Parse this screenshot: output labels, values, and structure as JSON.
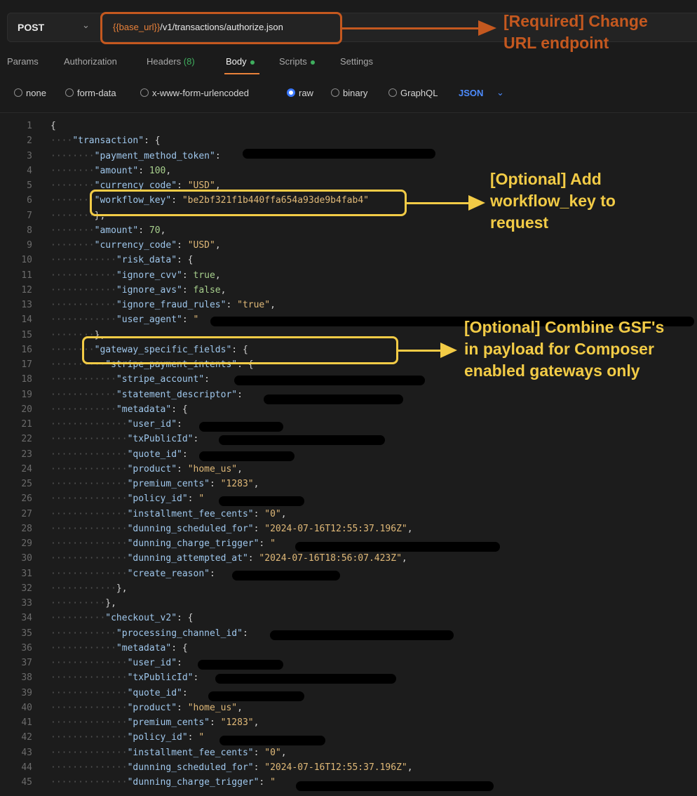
{
  "request": {
    "method": "POST",
    "method_chevron": "⌄",
    "url_var": "{{base_url}}",
    "url_path": "/v1/transactions/authorize.json"
  },
  "tabs": [
    {
      "label": "Params"
    },
    {
      "label": "Authorization"
    },
    {
      "label": "Headers",
      "count": "(8)"
    },
    {
      "label": "Body"
    },
    {
      "label": "Scripts"
    },
    {
      "label": "Settings"
    }
  ],
  "body_types": [
    "none",
    "form-data",
    "x-www-form-urlencoded",
    "raw",
    "binary",
    "GraphQL"
  ],
  "body_format": "JSON",
  "code_lines": [
    [
      [
        "p",
        "{"
      ]
    ],
    [
      [
        "g",
        "····"
      ],
      [
        "k",
        "\"transaction\""
      ],
      [
        "p",
        ": {"
      ]
    ],
    [
      [
        "g",
        "········"
      ],
      [
        "k",
        "\"payment_method_token\""
      ],
      [
        "p",
        ": "
      ]
    ],
    [
      [
        "g",
        "········"
      ],
      [
        "k",
        "\"amount\""
      ],
      [
        "p",
        ": "
      ],
      [
        "n",
        "100"
      ],
      [
        "p",
        ","
      ]
    ],
    [
      [
        "g",
        "········"
      ],
      [
        "k",
        "\"currency_code\""
      ],
      [
        "p",
        ": "
      ],
      [
        "s",
        "\"USD\""
      ],
      [
        "p",
        ","
      ]
    ],
    [
      [
        "g",
        "········"
      ],
      [
        "k",
        "\"workflow_key\""
      ],
      [
        "p",
        ": "
      ],
      [
        "s",
        "\"be2bf321f1b440ffa654a93de9b4fab4\""
      ]
    ],
    [
      [
        "g",
        "········"
      ],
      [
        "p",
        "},"
      ]
    ],
    [
      [
        "g",
        "········"
      ],
      [
        "k",
        "\"amount\""
      ],
      [
        "p",
        ": "
      ],
      [
        "n",
        "70"
      ],
      [
        "p",
        ","
      ]
    ],
    [
      [
        "g",
        "········"
      ],
      [
        "k",
        "\"currency_code\""
      ],
      [
        "p",
        ": "
      ],
      [
        "s",
        "\"USD\""
      ],
      [
        "p",
        ","
      ]
    ],
    [
      [
        "g",
        "············"
      ],
      [
        "k",
        "\"risk_data\""
      ],
      [
        "p",
        ": {"
      ]
    ],
    [
      [
        "g",
        "············"
      ],
      [
        "k",
        "\"ignore_cvv\""
      ],
      [
        "p",
        ": "
      ],
      [
        "n",
        "true"
      ],
      [
        "p",
        ","
      ]
    ],
    [
      [
        "g",
        "············"
      ],
      [
        "k",
        "\"ignore_avs\""
      ],
      [
        "p",
        ": "
      ],
      [
        "n",
        "false"
      ],
      [
        "p",
        ","
      ]
    ],
    [
      [
        "g",
        "············"
      ],
      [
        "k",
        "\"ignore_fraud_rules\""
      ],
      [
        "p",
        ": "
      ],
      [
        "s",
        "\"true\""
      ],
      [
        "p",
        ","
      ]
    ],
    [
      [
        "g",
        "············"
      ],
      [
        "k",
        "\"user_agent\""
      ],
      [
        "p",
        ": "
      ],
      [
        "s",
        "\""
      ]
    ],
    [
      [
        "g",
        "········"
      ],
      [
        "p",
        "},"
      ]
    ],
    [
      [
        "g",
        "········"
      ],
      [
        "k",
        "\"gateway_specific_fields\""
      ],
      [
        "p",
        ": {"
      ]
    ],
    [
      [
        "g",
        "··········"
      ],
      [
        "k",
        "\"stripe_payment_intents\""
      ],
      [
        "p",
        ": {"
      ]
    ],
    [
      [
        "g",
        "············"
      ],
      [
        "k",
        "\"stripe_account\""
      ],
      [
        "p",
        ": "
      ]
    ],
    [
      [
        "g",
        "············"
      ],
      [
        "k",
        "\"statement_descriptor\""
      ],
      [
        "p",
        ": "
      ]
    ],
    [
      [
        "g",
        "············"
      ],
      [
        "k",
        "\"metadata\""
      ],
      [
        "p",
        ": {"
      ]
    ],
    [
      [
        "g",
        "··············"
      ],
      [
        "k",
        "\"user_id\""
      ],
      [
        "p",
        ": "
      ]
    ],
    [
      [
        "g",
        "··············"
      ],
      [
        "k",
        "\"txPublicId\""
      ],
      [
        "p",
        ": "
      ]
    ],
    [
      [
        "g",
        "··············"
      ],
      [
        "k",
        "\"quote_id\""
      ],
      [
        "p",
        ": "
      ]
    ],
    [
      [
        "g",
        "··············"
      ],
      [
        "k",
        "\"product\""
      ],
      [
        "p",
        ": "
      ],
      [
        "s",
        "\"home_us\""
      ],
      [
        "p",
        ","
      ]
    ],
    [
      [
        "g",
        "··············"
      ],
      [
        "k",
        "\"premium_cents\""
      ],
      [
        "p",
        ": "
      ],
      [
        "s",
        "\"1283\""
      ],
      [
        "p",
        ","
      ]
    ],
    [
      [
        "g",
        "··············"
      ],
      [
        "k",
        "\"policy_id\""
      ],
      [
        "p",
        ": "
      ],
      [
        "s",
        "\""
      ]
    ],
    [
      [
        "g",
        "··············"
      ],
      [
        "k",
        "\"installment_fee_cents\""
      ],
      [
        "p",
        ": "
      ],
      [
        "s",
        "\"0\""
      ],
      [
        "p",
        ","
      ]
    ],
    [
      [
        "g",
        "··············"
      ],
      [
        "k",
        "\"dunning_scheduled_for\""
      ],
      [
        "p",
        ": "
      ],
      [
        "s",
        "\"2024-07-16T12:55:37.196Z\""
      ],
      [
        "p",
        ","
      ]
    ],
    [
      [
        "g",
        "··············"
      ],
      [
        "k",
        "\"dunning_charge_trigger\""
      ],
      [
        "p",
        ": "
      ],
      [
        "s",
        "\""
      ]
    ],
    [
      [
        "g",
        "··············"
      ],
      [
        "k",
        "\"dunning_attempted_at\""
      ],
      [
        "p",
        ": "
      ],
      [
        "s",
        "\"2024-07-16T18:56:07.423Z\""
      ],
      [
        "p",
        ","
      ]
    ],
    [
      [
        "g",
        "··············"
      ],
      [
        "k",
        "\"create_reason\""
      ],
      [
        "p",
        ": "
      ]
    ],
    [
      [
        "g",
        "············"
      ],
      [
        "p",
        "},"
      ]
    ],
    [
      [
        "g",
        "··········"
      ],
      [
        "p",
        "},"
      ]
    ],
    [
      [
        "g",
        "··········"
      ],
      [
        "k",
        "\"checkout_v2\""
      ],
      [
        "p",
        ": {"
      ]
    ],
    [
      [
        "g",
        "············"
      ],
      [
        "k",
        "\"processing_channel_id\""
      ],
      [
        "p",
        ": "
      ]
    ],
    [
      [
        "g",
        "············"
      ],
      [
        "k",
        "\"metadata\""
      ],
      [
        "p",
        ": {"
      ]
    ],
    [
      [
        "g",
        "··············"
      ],
      [
        "k",
        "\"user_id\""
      ],
      [
        "p",
        ": "
      ]
    ],
    [
      [
        "g",
        "··············"
      ],
      [
        "k",
        "\"txPublicId\""
      ],
      [
        "p",
        ": "
      ]
    ],
    [
      [
        "g",
        "··············"
      ],
      [
        "k",
        "\"quote_id\""
      ],
      [
        "p",
        ": "
      ]
    ],
    [
      [
        "g",
        "··············"
      ],
      [
        "k",
        "\"product\""
      ],
      [
        "p",
        ": "
      ],
      [
        "s",
        "\"home_us\""
      ],
      [
        "p",
        ","
      ]
    ],
    [
      [
        "g",
        "··············"
      ],
      [
        "k",
        "\"premium_cents\""
      ],
      [
        "p",
        ": "
      ],
      [
        "s",
        "\"1283\""
      ],
      [
        "p",
        ","
      ]
    ],
    [
      [
        "g",
        "··············"
      ],
      [
        "k",
        "\"policy_id\""
      ],
      [
        "p",
        ": "
      ],
      [
        "s",
        "\""
      ]
    ],
    [
      [
        "g",
        "··············"
      ],
      [
        "k",
        "\"installment_fee_cents\""
      ],
      [
        "p",
        ": "
      ],
      [
        "s",
        "\"0\""
      ],
      [
        "p",
        ","
      ]
    ],
    [
      [
        "g",
        "··············"
      ],
      [
        "k",
        "\"dunning_scheduled_for\""
      ],
      [
        "p",
        ": "
      ],
      [
        "s",
        "\"2024-07-16T12:55:37.196Z\""
      ],
      [
        "p",
        ","
      ]
    ],
    [
      [
        "g",
        "··············"
      ],
      [
        "k",
        "\"dunning_charge_trigger\""
      ],
      [
        "p",
        ": "
      ],
      [
        "s",
        "\""
      ]
    ]
  ],
  "annotations": {
    "required_line1": "[Required] Change",
    "required_line2": "URL endpoint",
    "optional1_line1": "[Optional] Add",
    "optional1_line2": "workflow_key to",
    "optional1_line3": "request",
    "optional2_line1": "[Optional] Combine GSF's",
    "optional2_line2": "in payload for Composer",
    "optional2_line3": "enabled gateways only"
  },
  "colors": {
    "required": "#c4581f",
    "optional": "#f2cb46",
    "active_dot": "#3fae5e",
    "json_blue": "#4d8cff"
  }
}
